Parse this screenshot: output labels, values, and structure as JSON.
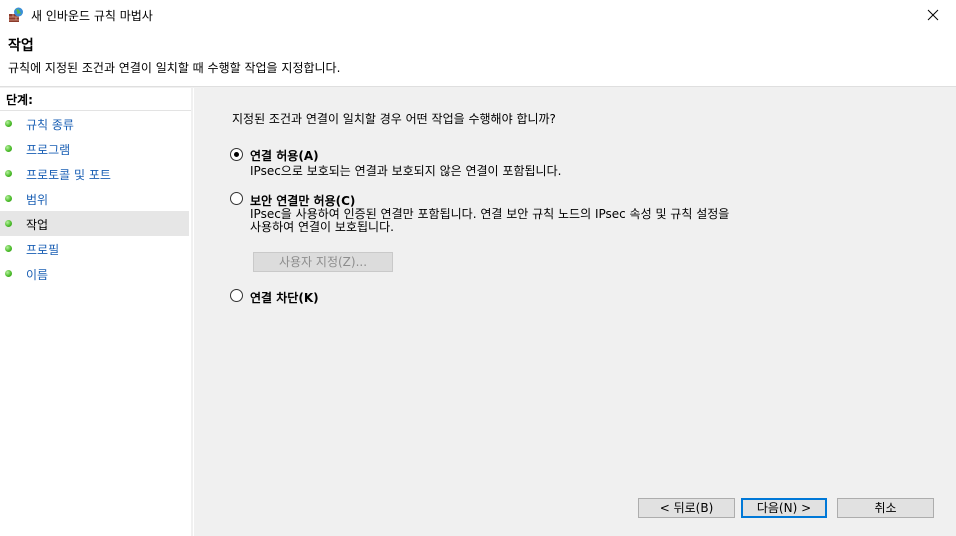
{
  "window": {
    "title": "새 인바운드 규칙 마법사"
  },
  "header": {
    "title": "작업",
    "description": "규칙에 지정된 조건과 연결이 일치할 때 수행할 작업을 지정합니다."
  },
  "steps": {
    "heading": "단계:",
    "items": [
      {
        "label": "규칙 종류"
      },
      {
        "label": "프로그램"
      },
      {
        "label": "프로토콜 및 포트"
      },
      {
        "label": "범위"
      },
      {
        "label": "작업"
      },
      {
        "label": "프로필"
      },
      {
        "label": "이름"
      }
    ],
    "active_index": 4
  },
  "main": {
    "question": "지정된 조건과 연결이 일치할 경우 어떤 작업을 수행해야 합니까?",
    "options": [
      {
        "label": "연결 허용(A)",
        "description": "IPsec으로 보호되는 연결과 보호되지 않은 연결이 포함됩니다.",
        "checked": true
      },
      {
        "label": "보안 연결만 허용(C)",
        "description_line1": "IPsec을 사용하여 인증된 연결만 포함됩니다. 연결 보안 규칙 노드의 IPsec 속성 및 규칙 설정을",
        "description_line2": "사용하여 연결이 보호됩니다.",
        "checked": false
      },
      {
        "label": "연결 차단(K)",
        "checked": false
      }
    ],
    "custom_button": "사용자 지정(Z)..."
  },
  "footer": {
    "back": "< 뒤로(B)",
    "next": "다음(N) >",
    "cancel": "취소"
  },
  "colors": {
    "link": "#1a5fb4",
    "step_dot": "#4fbf2e",
    "default_button_border": "#0078d7"
  }
}
